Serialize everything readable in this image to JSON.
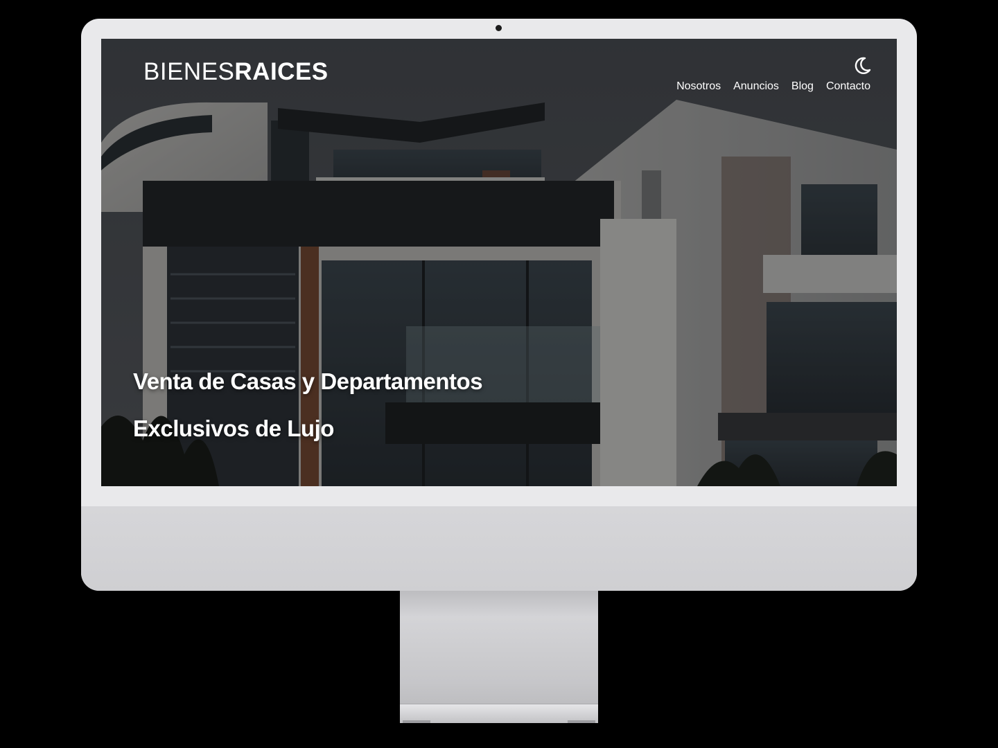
{
  "header": {
    "logo_light": "BIENES",
    "logo_bold": "RAICES",
    "theme_toggle_icon": "moon-icon"
  },
  "nav": {
    "items": [
      {
        "label": "Nosotros"
      },
      {
        "label": "Anuncios"
      },
      {
        "label": "Blog"
      },
      {
        "label": "Contacto"
      }
    ]
  },
  "hero": {
    "line1": "Venta de Casas y Departamentos",
    "line2": "Exclusivos de Lujo"
  },
  "colors": {
    "text": "#ffffff",
    "bezel": "#e9e9eb",
    "background": "#000000"
  }
}
